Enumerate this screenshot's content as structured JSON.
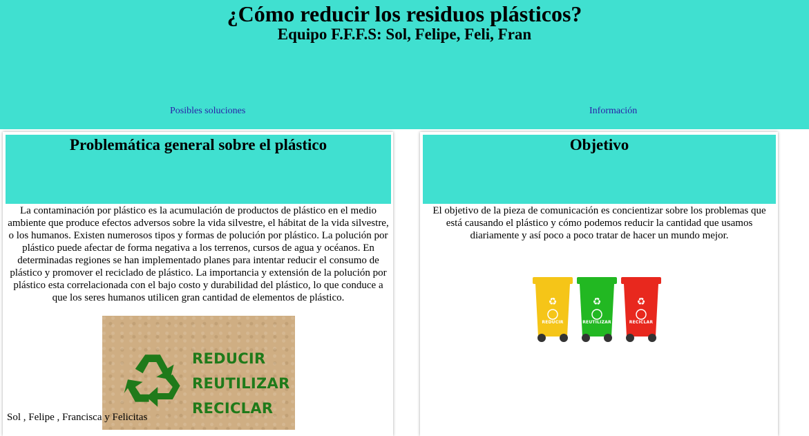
{
  "header": {
    "title": "¿Cómo reducir los residuos plásticos?",
    "subtitle": "Equipo F.F.F.S: Sol, Felipe, Feli, Fran",
    "nav": [
      {
        "label": "Posibles soluciones"
      },
      {
        "label": "Información"
      }
    ]
  },
  "left_card": {
    "heading": "Problemática general sobre el plástico",
    "text": "La contaminación por plástico es la acumulación de productos de plástico en el medio ambiente que produce efectos adversos sobre la vida silvestre, el hábitat de la vida silvestre, o los humanos. Existen numerosos tipos y formas de polución por plástico. La polución por plástico puede afectar de forma negativa a los terrenos, cursos de agua y océanos. En determinadas regiones se han implementado planes para intentar reducir el consumo de plástico y promover el reciclado de plástico. La importancia y extensión de la polución por plástico esta correlacionada con el bajo costo y durabilidad del plástico, lo que conduce a que los seres humanos utilicen gran cantidad de elementos de plástico.",
    "image_slogan": [
      "REDUCIR",
      "REUTILIZAR",
      "RECICLAR"
    ],
    "footer": "Sol , Felipe , Francisca y Felicitas"
  },
  "right_card": {
    "heading": "Objetivo",
    "text": "El objetivo de la pieza de comunicación es concientizar sobre los problemas que está causando el plástico y cómo podemos reducir la cantidad que usamos diariamente y así poco a poco tratar de hacer un mundo mejor.",
    "bins": [
      {
        "label": "REDUCIR",
        "color": "#f5c518"
      },
      {
        "label": "REUTILIZAR",
        "color": "#22b822"
      },
      {
        "label": "RECICLAR",
        "color": "#e8281e"
      }
    ]
  },
  "colors": {
    "accent": "#40e0d0",
    "link": "#2a20a8",
    "recycle_green": "#1f7a1a",
    "kraft": "#cfae83"
  },
  "icons": [
    "recycle-icon"
  ]
}
